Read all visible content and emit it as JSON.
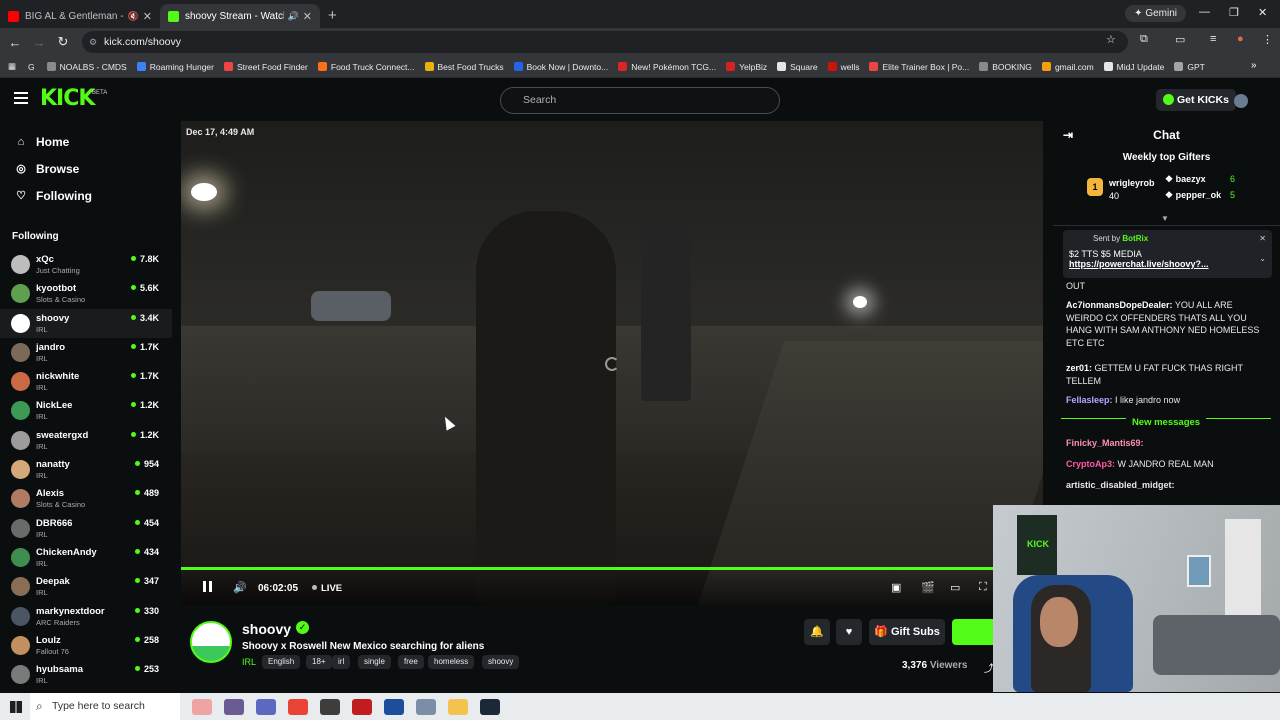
{
  "browser": {
    "tabs": [
      {
        "title": "BIG AL & Gentleman - Deep",
        "icon": "youtube-icon",
        "color": "#ff0000"
      },
      {
        "title": "shoovy Stream - Watch Live",
        "icon": "kick-icon",
        "color": "#53fc18"
      }
    ],
    "gemini_label": "Gemini",
    "url": "kick.com/shoovy",
    "bookmarks": [
      {
        "label": "NOALBS - CMDS",
        "color": "#8a8a8a"
      },
      {
        "label": "Roaming Hunger",
        "color": "#3b82f6"
      },
      {
        "label": "Street Food Finder",
        "color": "#ef4444"
      },
      {
        "label": "Food Truck Connect...",
        "color": "#f97316"
      },
      {
        "label": "Best Food Trucks",
        "color": "#eab308"
      },
      {
        "label": "Book Now | Downto...",
        "color": "#2563eb"
      },
      {
        "label": "New! Pokémon TCG...",
        "color": "#dc2626"
      },
      {
        "label": "YelpBiz",
        "color": "#d32323"
      },
      {
        "label": "Square",
        "color": "#e5e5e5"
      },
      {
        "label": "wells",
        "color": "#cd1409"
      },
      {
        "label": "Elite Trainer Box | Po...",
        "color": "#ef4444"
      },
      {
        "label": "BOOKING",
        "color": "#8a8a8a"
      },
      {
        "label": "gmail.com",
        "color": "#f59e0b"
      },
      {
        "label": "MidJ Update",
        "color": "#e5e5e5"
      },
      {
        "label": "GPT",
        "color": "#a3a3a3"
      }
    ]
  },
  "header": {
    "logo": "KICK",
    "beta": "BETA",
    "search_placeholder": "Search",
    "get_kicks": "Get KICKs"
  },
  "sidebar": {
    "nav": [
      {
        "label": "Home",
        "icon": "home-icon",
        "glyph": "⌂"
      },
      {
        "label": "Browse",
        "icon": "compass-icon",
        "glyph": "◎"
      },
      {
        "label": "Following",
        "icon": "heart-icon",
        "glyph": "♡"
      }
    ],
    "following_title": "Following",
    "channels": [
      {
        "name": "xQc",
        "category": "Just Chatting",
        "viewers": "7.8K",
        "color": "#bdbdbd"
      },
      {
        "name": "kyootbot",
        "category": "Slots & Casino",
        "viewers": "5.6K",
        "color": "#5ea04f"
      },
      {
        "name": "shoovy",
        "category": "IRL",
        "viewers": "3.4K",
        "color": "#ffffff"
      },
      {
        "name": "jandro",
        "category": "IRL",
        "viewers": "1.7K",
        "color": "#7c6a58"
      },
      {
        "name": "nickwhite",
        "category": "IRL",
        "viewers": "1.7K",
        "color": "#c96a44"
      },
      {
        "name": "NickLee",
        "category": "IRL",
        "viewers": "1.2K",
        "color": "#3d9a55"
      },
      {
        "name": "sweatergxd",
        "category": "IRL",
        "viewers": "1.2K",
        "color": "#9c9c9c"
      },
      {
        "name": "nanatty",
        "category": "IRL",
        "viewers": "954",
        "color": "#d4a87a"
      },
      {
        "name": "Alexis",
        "category": "Slots & Casino",
        "viewers": "489",
        "color": "#b07b62"
      },
      {
        "name": "DBR666",
        "category": "IRL",
        "viewers": "454",
        "color": "#6a6a6a"
      },
      {
        "name": "ChickenAndy",
        "category": "IRL",
        "viewers": "434",
        "color": "#3e8e4f"
      },
      {
        "name": "Deepak",
        "category": "IRL",
        "viewers": "347",
        "color": "#8a6d55"
      },
      {
        "name": "markynextdoor",
        "category": "ARC Raiders",
        "viewers": "330",
        "color": "#4b5563"
      },
      {
        "name": "Loulz",
        "category": "Fallout 76",
        "viewers": "258",
        "color": "#c2905e"
      },
      {
        "name": "hyubsama",
        "category": "IRL",
        "viewers": "253",
        "color": "#7a7a7a"
      }
    ]
  },
  "player": {
    "timestamp": "Dec 17, 4:49 AM",
    "time": "06:02:05",
    "live": "LIVE"
  },
  "stream": {
    "name": "shoovy",
    "title": "Shoovy x Roswell New Mexico searching for aliens",
    "category": "IRL",
    "tags": [
      "English",
      "18+",
      "irl",
      "single",
      "free",
      "homeless",
      "shoovy"
    ],
    "gift_subs": "Gift Subs",
    "viewers": "3,376",
    "viewers_label": "Viewers"
  },
  "chat": {
    "title": "Chat",
    "gifters_title": "Weekly top Gifters",
    "top_gifter": {
      "rank": "1",
      "name": "wrigleyrob",
      "count": "40"
    },
    "gifters": [
      {
        "name": "baezyx",
        "count": "6"
      },
      {
        "name": "pepper_ok",
        "count": "5"
      }
    ],
    "pinned": {
      "sent_by_label": "Sent by",
      "sender": "BotRix",
      "message": "$2 TTS $5 MEDIA",
      "link": "https://powerchat.live/shoovy?..."
    },
    "partial_above": "OUT",
    "messages": [
      {
        "user": "Ac7ionmansDopeDealer:",
        "text": " YOU ALL ARE WEIRDO CX OFFENDERS THATS ALL YOU HANG WITH SAM ANTHONY NED HOMELESS ETC ETC",
        "color": "#ffffff"
      },
      {
        "user": "zer01:",
        "text": " GETTEM U FAT FUCK THAS RIGHT TELLEM",
        "color": "#ffffff"
      },
      {
        "user": "Fellasleep:",
        "text": " I like jandro now",
        "color": "#b8a6ff"
      }
    ],
    "new_messages": "New messages",
    "new": [
      {
        "user": "Finicky_Mantis69:",
        "text": "",
        "color": "#ff8fb2"
      },
      {
        "user": "CryptoAp3:",
        "text": " W JANDRO REAL MAN",
        "color": "#ff5aa8"
      },
      {
        "user": "artistic_disabled_midget:",
        "text": "",
        "color": "#e8e8e8"
      }
    ]
  },
  "webcam": {
    "poster_text": "KICK"
  },
  "taskbar": {
    "search_placeholder": "Type here to search",
    "apps": [
      {
        "icon": "app-icon-1",
        "color": "#f0a3a3"
      },
      {
        "icon": "app-icon-2",
        "color": "#6b5b95"
      },
      {
        "icon": "app-icon-3",
        "color": "#5b6abf"
      },
      {
        "icon": "chrome-icon",
        "color": "#e94335"
      },
      {
        "icon": "app-icon-5",
        "color": "#3d3d3d"
      },
      {
        "icon": "app-icon-6",
        "color": "#c21d1d"
      },
      {
        "icon": "app-icon-7",
        "color": "#1b4f9c"
      },
      {
        "icon": "app-icon-8",
        "color": "#7a8ea8"
      },
      {
        "icon": "explorer-icon",
        "color": "#f3c24f"
      },
      {
        "icon": "steam-icon",
        "color": "#1b2838"
      }
    ]
  }
}
